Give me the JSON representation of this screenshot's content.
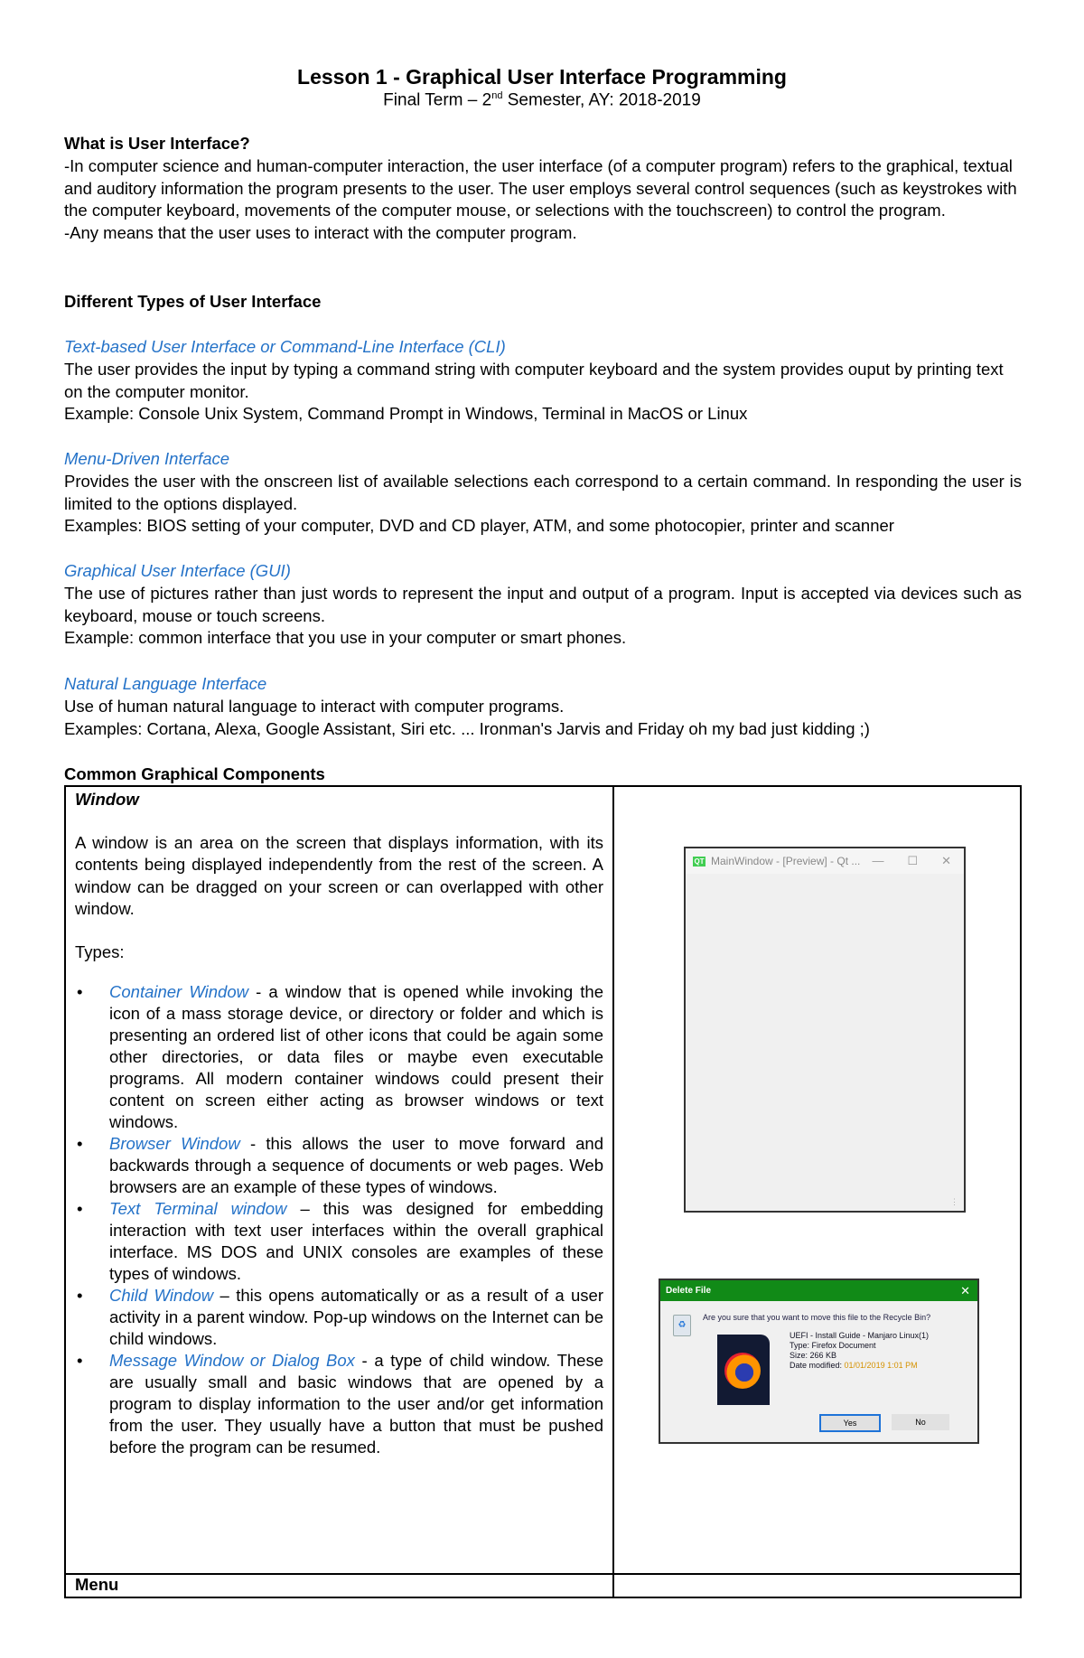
{
  "header": {
    "title": "Lesson 1 - Graphical User Interface Programming",
    "subtitle_pre": "Final Term – 2",
    "subtitle_sup": "nd",
    "subtitle_post": " Semester, AY: 2018-2019"
  },
  "what_is_ui": {
    "heading": "What is User Interface?",
    "para1": "-In computer science and human-computer interaction, the user interface (of a computer program) refers to the graphical, textual and auditory information the program presents to the user. The user employs several control sequences (such as keystrokes with the computer keyboard, movements of the computer mouse, or selections with the touchscreen) to control the program.",
    "para2": "-Any means that the user uses to interact with the computer program."
  },
  "types_section": {
    "heading": "Different Types of User Interface",
    "types": [
      {
        "name": "Text-based User Interface or Command-Line Interface (CLI)",
        "desc": "The user provides the input by typing a command string with computer keyboard and the system provides ouput by printing text on the computer monitor.",
        "example": "Example: Console Unix System, Command Prompt in Windows, Terminal in MacOS or Linux"
      },
      {
        "name": "Menu-Driven Interface",
        "desc": "Provides the user with the onscreen list of available selections each correspond to a certain command. In responding the user is limited to the options displayed.",
        "example": "Examples: BIOS setting of your computer, DVD and CD player, ATM, and some photocopier, printer and scanner"
      },
      {
        "name": "Graphical User Interface (GUI)",
        "desc": "The use of pictures rather than just words to represent the input and output of a program. Input is accepted via devices such as keyboard, mouse or touch screens.",
        "example": "Example: common interface that you use in your computer or smart phones."
      },
      {
        "name": "Natural Language Interface",
        "desc": "Use of human natural language to interact with computer programs.",
        "example": "Examples: Cortana, Alexa, Google Assistant, Siri etc. ... Ironman's Jarvis and Friday oh my bad just kidding ;)"
      }
    ]
  },
  "components": {
    "heading": "Common Graphical Components",
    "window": {
      "title": "Window",
      "description": "A window is an area on the screen that displays information, with its contents being displayed independently from the rest of the screen. A window can be dragged on your screen or can overlapped with other window.",
      "types_label": "Types:",
      "types": [
        {
          "name": "Container Window",
          "sep": " - ",
          "desc": "a window that is opened while invoking the icon of a mass storage device, or directory or folder and which is presenting an ordered list of other icons that could be again some other directories, or data files or maybe even executable programs. All modern container windows could present their content on screen either acting as browser windows or text windows."
        },
        {
          "name": "Browser Window",
          "sep": " -  ",
          "desc": "this allows the user to move forward and backwards through a sequence of documents or web pages. Web browsers are an example of these types of windows."
        },
        {
          "name": "Text Terminal window",
          "sep": " – ",
          "desc": "this was designed for embedding interaction with text user interfaces within the overall graphical interface. MS DOS and UNIX consoles are examples of these types of windows."
        },
        {
          "name": "Child Window",
          "sep": " – ",
          "desc": "this opens automatically or as a result of a user activity in a parent window. Pop-up windows on the Internet can be child windows."
        },
        {
          "name": "Message Window or Dialog Box",
          "sep": " - ",
          "desc": "a type of child window. These are usually small and basic windows that are opened by a program to display information to the user and/or get information from the user. They usually have a button that must be pushed before the program can be resumed."
        }
      ],
      "screenshot_main": {
        "app_icon": "QT",
        "title": "MainWindow - [Preview] - Qt ...",
        "minimize": "—",
        "maximize": "☐",
        "close": "✕"
      },
      "screenshot_dialog": {
        "title": "Delete File",
        "close": "✕",
        "question": "Are you sure that you want to move this file to the Recycle Bin?",
        "file_name": "UEFI - Install Guide - Manjaro Linux(1)",
        "file_type": "Type: Firefox Document",
        "file_size": "Size: 266 KB",
        "date_label": "Date modified: ",
        "date_value": "01/01/2019 1:01 PM",
        "yes": "Yes",
        "no": "No"
      }
    },
    "menu": {
      "title": "Menu"
    }
  }
}
